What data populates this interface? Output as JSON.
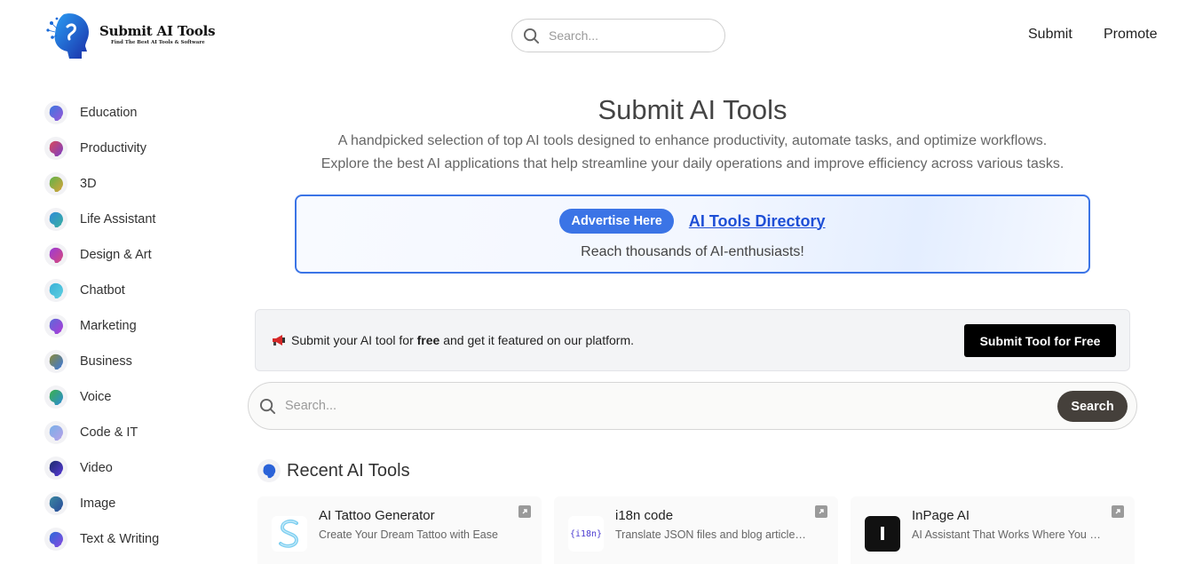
{
  "header": {
    "logo_title": "Submit AI Tools",
    "logo_tagline": "Find The Best AI Tools & Software",
    "search_placeholder": "Search...",
    "nav": [
      "Submit",
      "Promote"
    ]
  },
  "sidebar": {
    "items": [
      {
        "label": "Education",
        "icon": "category-head-icon"
      },
      {
        "label": "Productivity",
        "icon": "category-head-icon"
      },
      {
        "label": "3D",
        "icon": "category-head-icon"
      },
      {
        "label": "Life Assistant",
        "icon": "category-head-icon"
      },
      {
        "label": "Design & Art",
        "icon": "category-head-icon"
      },
      {
        "label": "Chatbot",
        "icon": "category-head-icon"
      },
      {
        "label": "Marketing",
        "icon": "category-head-icon"
      },
      {
        "label": "Business",
        "icon": "category-head-icon"
      },
      {
        "label": "Voice",
        "icon": "category-head-icon"
      },
      {
        "label": "Code & IT",
        "icon": "category-head-icon"
      },
      {
        "label": "Video",
        "icon": "category-head-icon"
      },
      {
        "label": "Image",
        "icon": "category-head-icon"
      },
      {
        "label": "Text & Writing",
        "icon": "category-head-icon"
      }
    ]
  },
  "hero": {
    "title": "Submit AI Tools",
    "subtitle_line1": "A handpicked selection of top AI tools designed to enhance productivity, automate tasks, and optimize workflows.",
    "subtitle_line2": "Explore the best AI applications that help streamline your daily operations and improve efficiency across various tasks."
  },
  "ad": {
    "pill": "Advertise Here",
    "link": "AI Tools Directory",
    "subtitle": "Reach thousands of AI-enthusiasts!"
  },
  "submit_bar": {
    "text_before": "Submit your AI tool for ",
    "text_bold": "free",
    "text_after": " and get it featured on our platform.",
    "button": "Submit Tool for Free"
  },
  "main_search": {
    "placeholder": "Search...",
    "button": "Search"
  },
  "recent": {
    "title": "Recent AI Tools",
    "cards": [
      {
        "title": "AI Tattoo Generator",
        "desc": "Create Your Dream Tattoo with Ease",
        "logo_text": "S"
      },
      {
        "title": "i18n code",
        "desc": "Translate JSON files and blog articles with AI",
        "logo_text": "{i18n}"
      },
      {
        "title": "InPage AI",
        "desc": "AI Assistant That Works Where You Work",
        "logo_text": "I"
      }
    ]
  },
  "colors": {
    "accent": "#3b74e6",
    "link": "#1e4fd6",
    "search_button": "#45403b"
  }
}
